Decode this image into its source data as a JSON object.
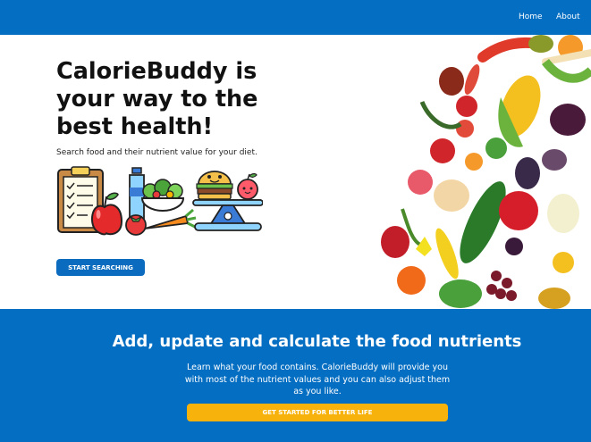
{
  "nav": {
    "links": [
      {
        "label": "Home"
      },
      {
        "label": "About"
      }
    ]
  },
  "hero": {
    "title": "CalorieBuddy is your way to the best health!",
    "subtitle": "Search food and their nutrient value for your diet.",
    "cta_label": "START SEARCHING",
    "illustration_icons": [
      "clipboard-icon",
      "apple-icon",
      "water-bottle-icon",
      "salad-bowl-icon",
      "carrot-icon",
      "tomato-icon",
      "burger-icon",
      "weighing-scale-icon"
    ]
  },
  "band": {
    "title": "Add, update and calculate the food nutrients",
    "text": "Learn what your food contains. CalorieBuddy will provide you with most of the nutrient values and you can also adjust them as you like.",
    "cta_label": "GET STARTED FOR BETTER LIFE"
  },
  "colors": {
    "primary": "#046ec2",
    "accent": "#f7b30c",
    "text": "#111111"
  }
}
